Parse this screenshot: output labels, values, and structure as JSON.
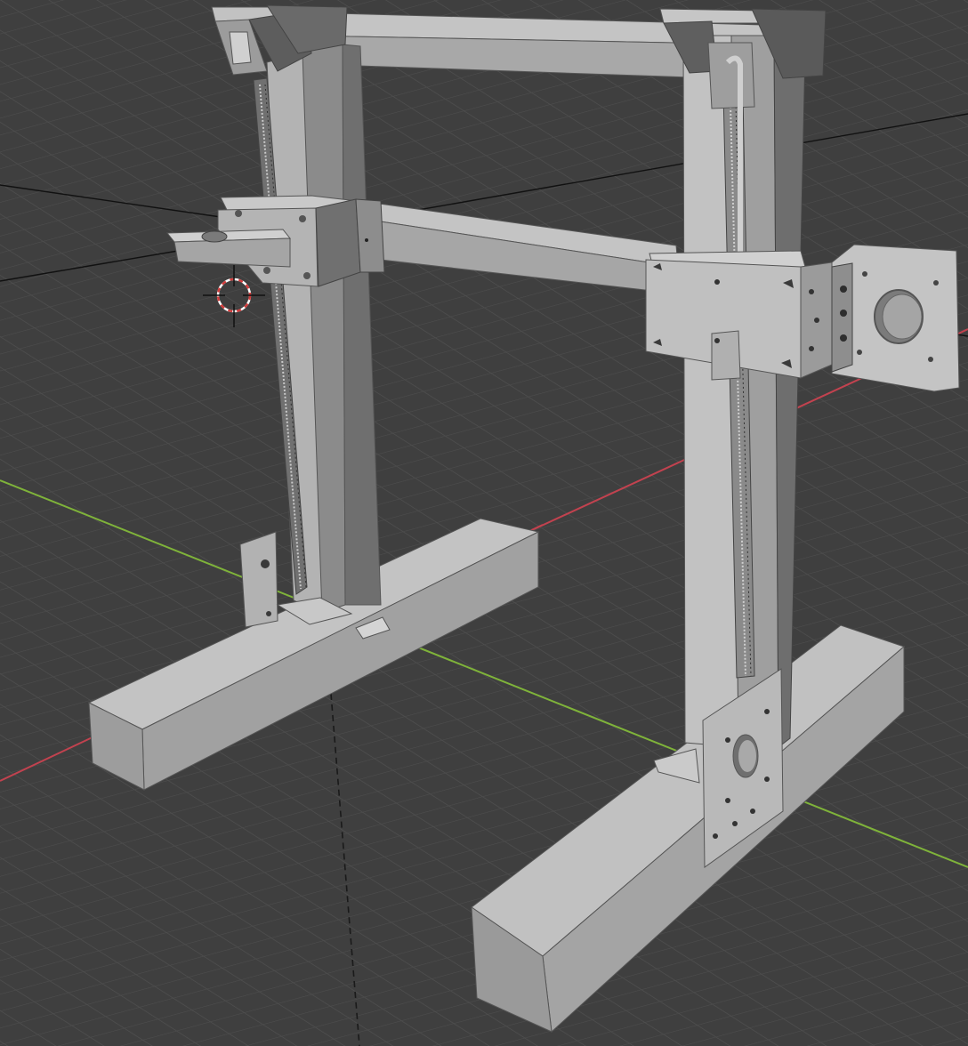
{
  "viewport": {
    "background": "#3f3f3f",
    "grid_color": "#4a4a4a",
    "axis_x_color": "#c2424f",
    "axis_y_color": "#7fb33a",
    "axis_z_color": "#1a1a1a"
  },
  "model": {
    "face_light": "#b8b8b8",
    "face_mid": "#9a9a9a",
    "face_dark": "#6e6e6e",
    "face_shadow": "#595959",
    "edge": "#4a4a4a"
  },
  "cursor": {
    "icon": "3d-cursor-icon",
    "ring_red": "#d23b3b",
    "ring_white": "#ffffff"
  }
}
